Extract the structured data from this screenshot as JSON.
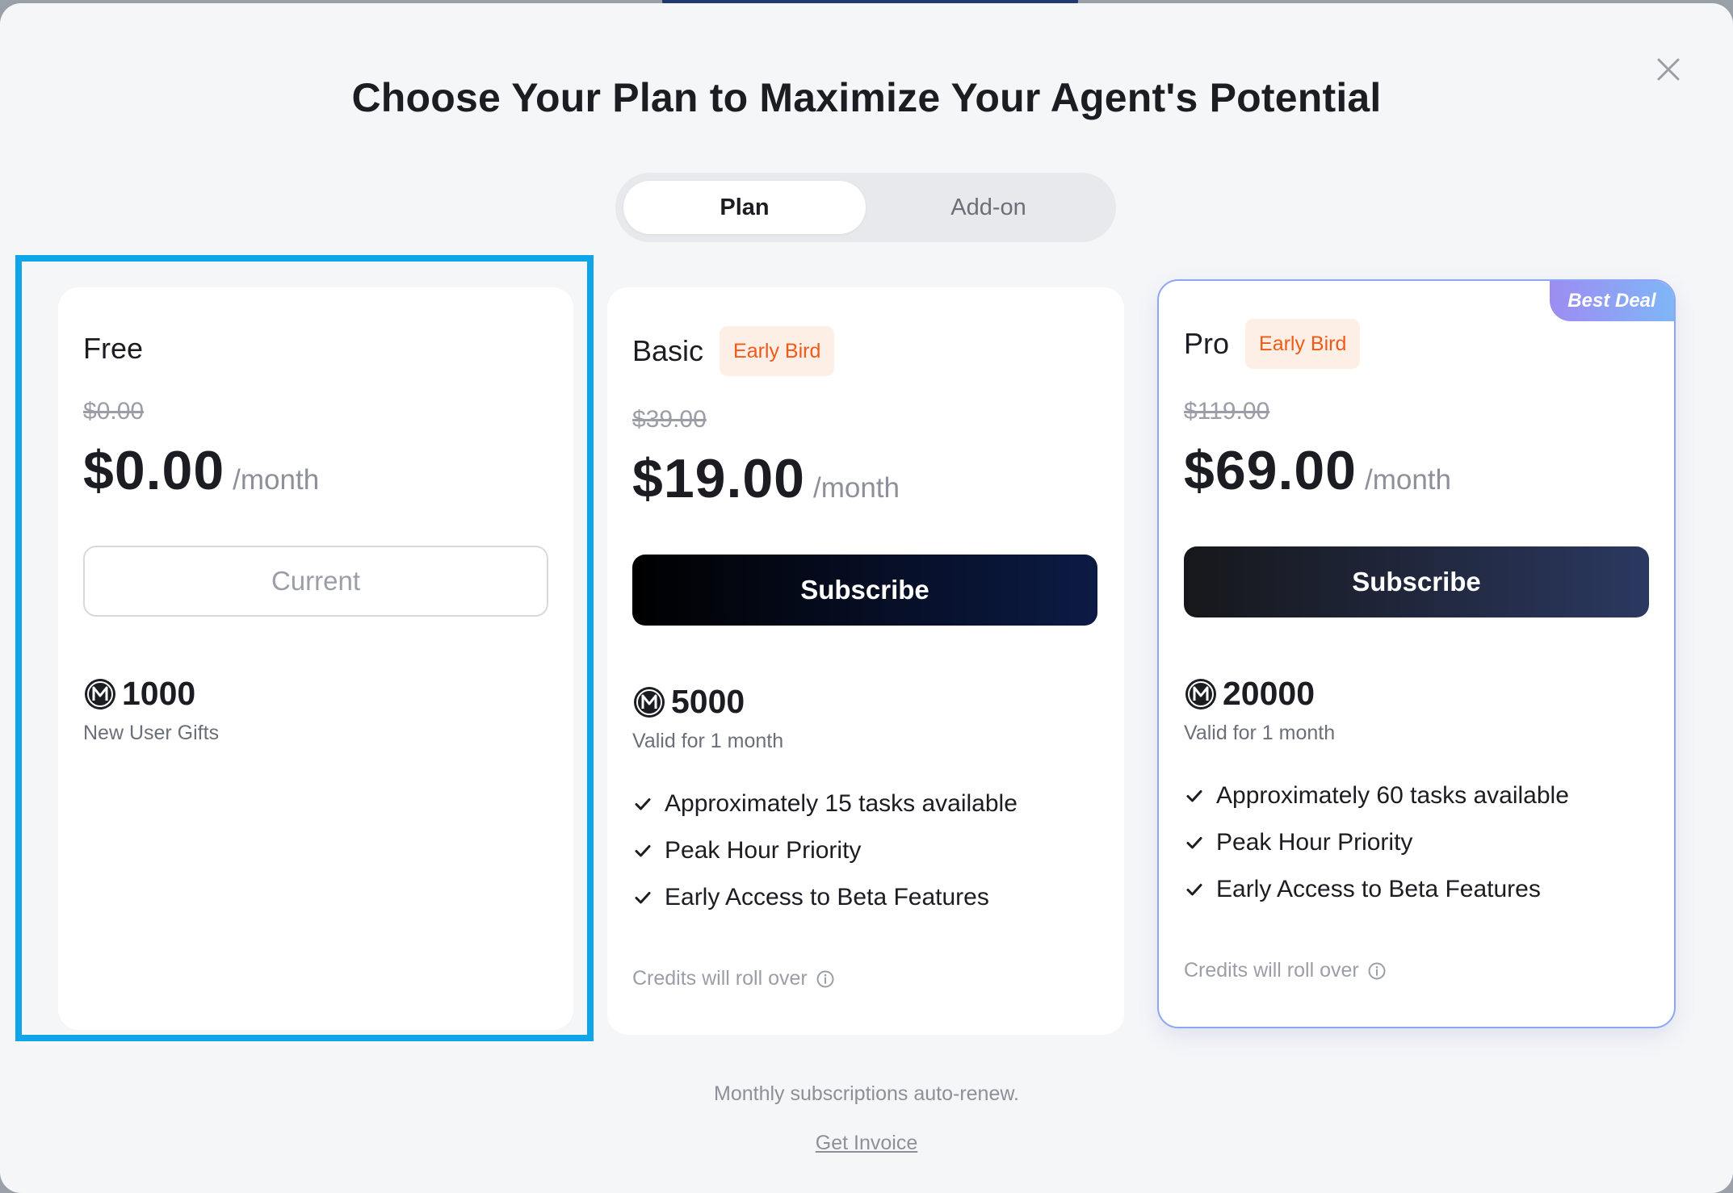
{
  "title": "Choose Your Plan to Maximize Your Agent's Potential",
  "tabs": [
    {
      "label": "Plan",
      "active": true
    },
    {
      "label": "Add-on",
      "active": false
    }
  ],
  "colors": {
    "accent_highlight": "#0ea5e9",
    "badge_text": "#ef5a16",
    "badge_bg": "#fdeee6",
    "best_deal_gradient_start": "#9d8cf2",
    "best_deal_gradient_end": "#7fb6f6"
  },
  "plans": [
    {
      "name": "Free",
      "badge": "",
      "old_price": "$0.00",
      "price": "$0.00",
      "per": "/month",
      "button": "Current",
      "credits": "1000",
      "credits_note": "New User Gifts",
      "features": [],
      "rollover": ""
    },
    {
      "name": "Basic",
      "badge": "Early Bird",
      "old_price": "$39.00",
      "price": "$19.00",
      "per": "/month",
      "button": "Subscribe",
      "credits": "5000",
      "credits_note": "Valid for 1 month",
      "features": [
        "Approximately 15 tasks available",
        "Peak Hour Priority",
        "Early Access to Beta Features"
      ],
      "rollover": "Credits will roll over"
    },
    {
      "name": "Pro",
      "badge": "Early Bird",
      "ribbon": "Best Deal",
      "old_price": "$119.00",
      "price": "$69.00",
      "per": "/month",
      "button": "Subscribe",
      "credits": "20000",
      "credits_note": "Valid for 1 month",
      "features": [
        "Approximately 60 tasks available",
        "Peak Hour Priority",
        "Early Access to Beta Features"
      ],
      "rollover": "Credits will roll over"
    }
  ],
  "footer": {
    "note": "Monthly subscriptions auto-renew.",
    "invoice_link": "Get Invoice"
  },
  "icons": {
    "close": "close-icon",
    "coin": "credit-coin-icon",
    "check": "check-icon",
    "info": "info-icon"
  }
}
